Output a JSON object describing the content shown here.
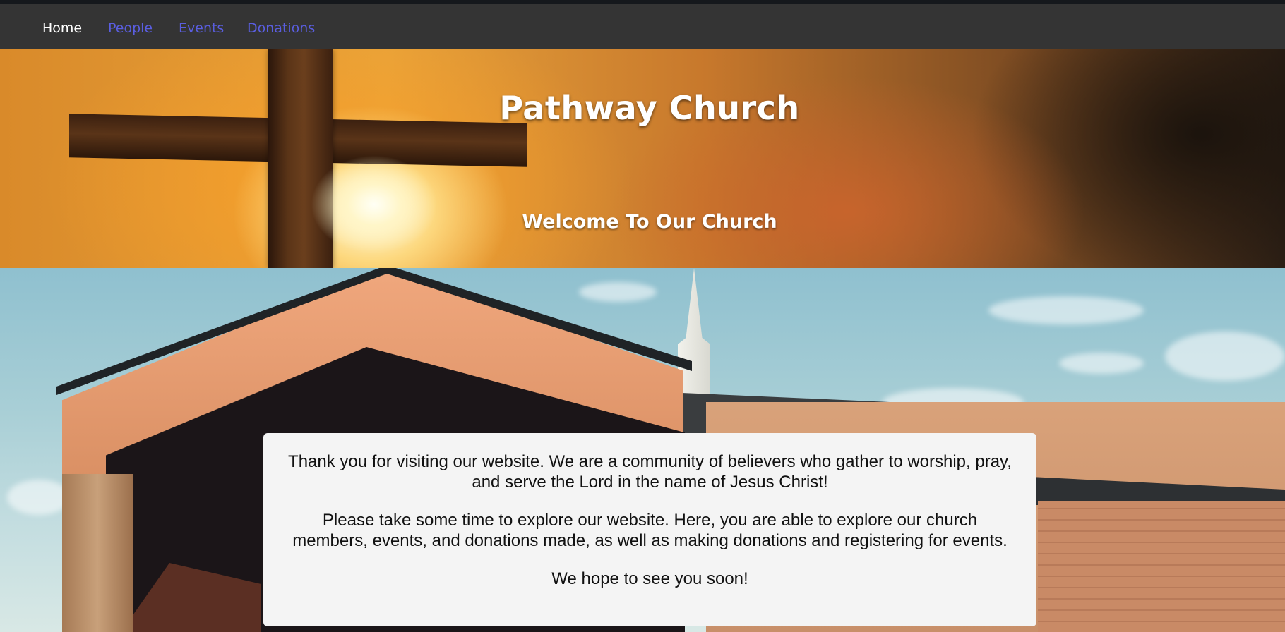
{
  "nav": {
    "items": [
      {
        "label": "Home",
        "active": true
      },
      {
        "label": "People",
        "active": false
      },
      {
        "label": "Events",
        "active": false
      },
      {
        "label": "Donations",
        "active": false
      }
    ]
  },
  "hero": {
    "title": "Pathway Church",
    "subtitle": "Welcome To Our Church"
  },
  "content": {
    "paragraphs": [
      "Thank you for visiting our website. We are a community of believers who gather to worship, pray, and serve the Lord in the name of Jesus Christ!",
      "Please take some time to explore our website. Here, you are able to explore our church members, events, and donations made, as well as making donations and registering for events.",
      "We hope to see you soon!"
    ]
  },
  "colors": {
    "navbar_bg": "#343434",
    "nav_active": "#ffffff",
    "nav_link": "#5a5ee0",
    "card_bg": "#f4f4f4"
  }
}
